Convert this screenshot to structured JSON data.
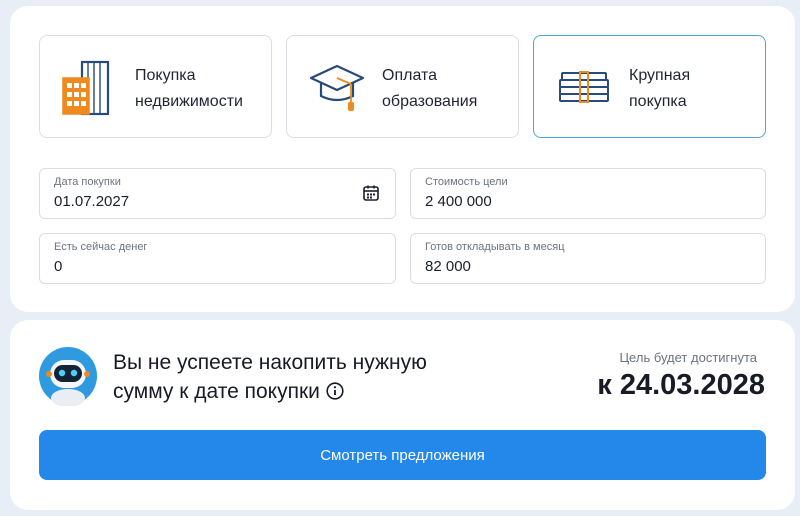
{
  "goals": [
    {
      "line1": "Покупка",
      "line2": "недвижимости",
      "icon": "building-icon",
      "selected": false
    },
    {
      "line1": "Оплата",
      "line2": "образования",
      "icon": "graduation-cap-icon",
      "selected": false
    },
    {
      "line1": "Крупная",
      "line2": "покупка",
      "icon": "money-stack-icon",
      "selected": true
    }
  ],
  "fields": {
    "purchase_date": {
      "label": "Дата покупки",
      "value": "01.07.2027",
      "icon": "calendar-icon"
    },
    "goal_cost": {
      "label": "Стоимость цели",
      "value": "2 400 000"
    },
    "money_now": {
      "label": "Есть сейчас денег",
      "value": "0"
    },
    "monthly_saving": {
      "label": "Готов откладывать в месяц",
      "value": "82 000"
    }
  },
  "result": {
    "message": "Вы не успеете накопить нужную сумму к дате покупки",
    "goal_reached_label": "Цель будет достигнута",
    "goal_date": "к 24.03.2028",
    "avatar_icon": "robot-assistant-icon",
    "info_icon": "info-icon",
    "cta_label": "Смотреть предложения"
  },
  "colors": {
    "accent": "#2388ea",
    "icon_blue": "#2a4a78",
    "icon_orange": "#ee8a1e",
    "selected_border": "#4aa8d8"
  }
}
